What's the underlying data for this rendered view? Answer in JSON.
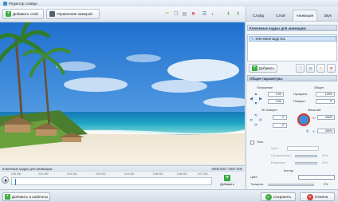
{
  "window": {
    "title": "Редактор слайда"
  },
  "toolbar": {
    "add_layer_label": "Добавить слой",
    "camera_label": "Управление камерой"
  },
  "tabs": [
    {
      "label": "Слайд"
    },
    {
      "label": "Слой"
    },
    {
      "label": "Анимация"
    },
    {
      "label": "Звук"
    }
  ],
  "keyframes_section": {
    "title": "Ключевые кадры для анимации:",
    "items": [
      {
        "label": "Ключевой кадр №1"
      }
    ],
    "add_label": "Добавить"
  },
  "params": {
    "title": "Общие параметры:",
    "position_label": "Положение",
    "general_label": "Общее",
    "transparency_label": "Прозрачн...",
    "transparency_value": "100%",
    "rotation_label": "Поворот:",
    "rotation_value": "0°",
    "pos_x_value": "0.00",
    "pos_y_value": "0.00",
    "turn3d_label": "3D поворот",
    "scale_label": "Масштаб",
    "turn_x_value": "0°",
    "turn_y_value": "0°",
    "scale_x_label": "X:",
    "scale_x_value": "400%",
    "scale_y_label": "Y:",
    "scale_y_value": "400%",
    "shadow_label": "Тень",
    "shadow_color_label": "Цвет:",
    "shadow_transparency_label": "Прозрачность:",
    "shadow_transparency_value": "50%",
    "shadow_blur_label": "Размытие:",
    "shadow_blur_value": "20%",
    "contour_label": "Контур",
    "contour_color_label": "Цвет:",
    "thickness_label": "Толщина:",
    "thickness_value": "0%"
  },
  "timeline": {
    "title": "Ключевые кадры для анимации:",
    "time_current": "0000.000",
    "time_total": "0007.000",
    "ticks": [
      "0:00.000",
      "0:01.000",
      "0:02.000",
      "0:03.000",
      "0:04.000",
      "0:05.000",
      "0:06.000",
      "0:07.000"
    ],
    "add_keyframe_label": "Добавить"
  },
  "bottom": {
    "add_to_templates_label": "Добавить в шаблоны",
    "save_label": "Сохранить",
    "cancel_label": "Отмена"
  },
  "colors": {
    "accent": "#3a8ed6",
    "save_button": "#3fae45",
    "cancel_button": "#d8403a",
    "highlight_circle": "#e0322a"
  }
}
